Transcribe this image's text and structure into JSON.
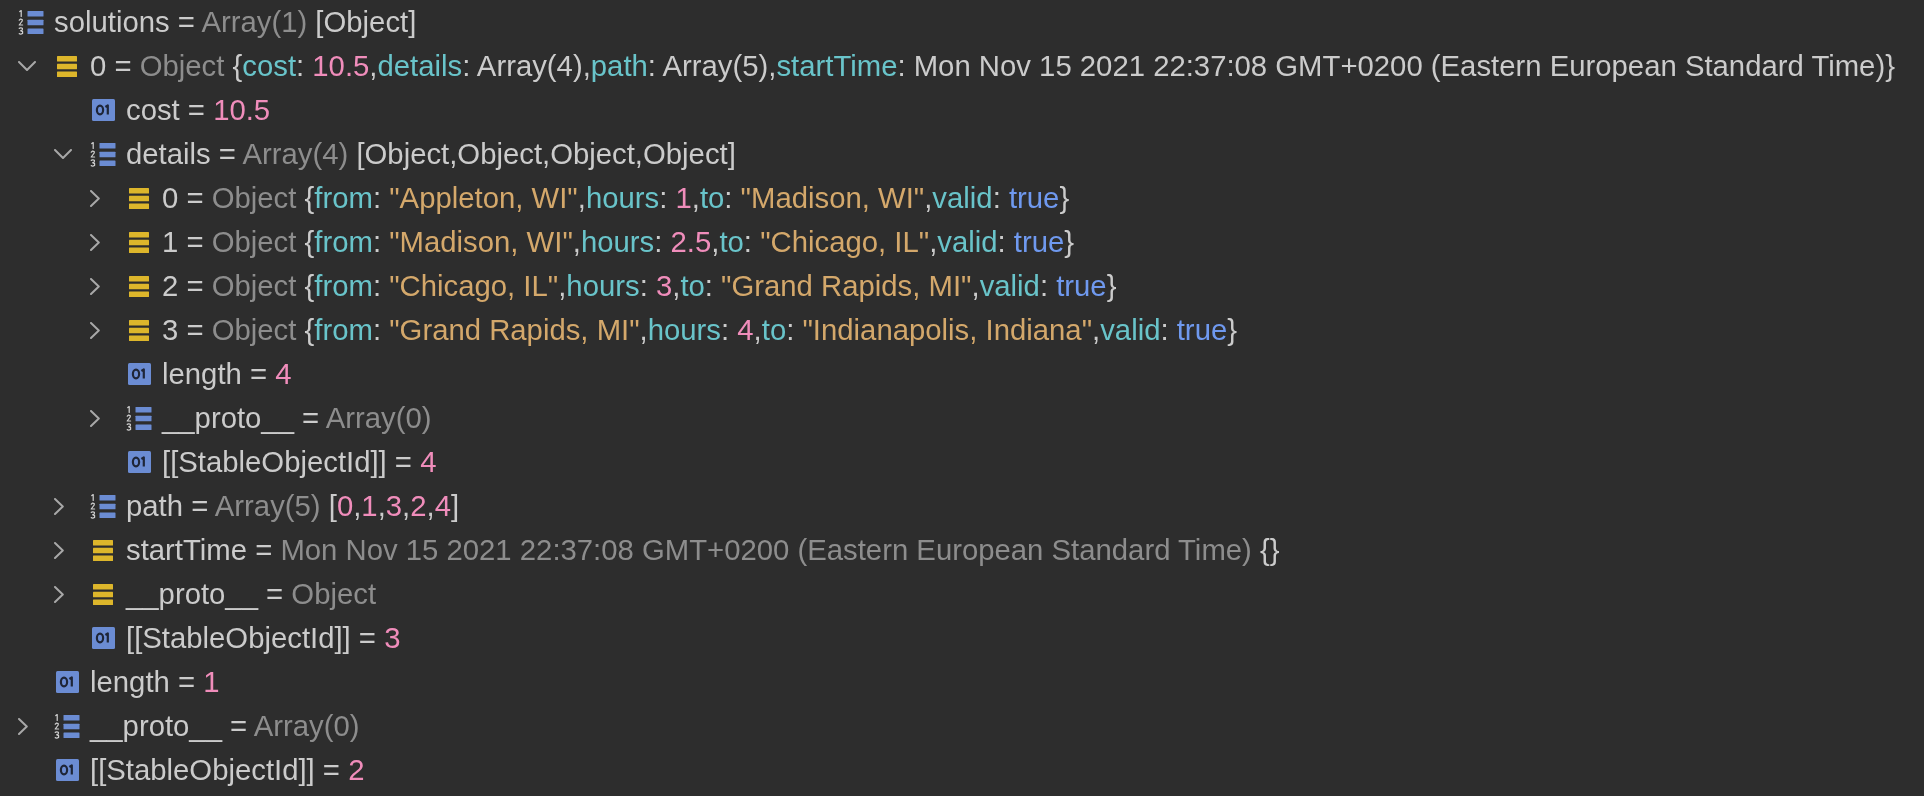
{
  "variables": [
    {
      "kind": "array",
      "line": [
        {
          "kind": "plain",
          "text": "solutions = "
        },
        {
          "kind": "type",
          "text": "Array(1)"
        },
        {
          "kind": "plain",
          "text": " [Object]"
        }
      ],
      "children": [
        {
          "kind": "object",
          "expanded": true,
          "line": [
            {
              "kind": "plain",
              "text": "0 = "
            },
            {
              "kind": "type",
              "text": "Object"
            },
            {
              "kind": "plain",
              "text": " {"
            },
            {
              "kind": "key",
              "text": "cost"
            },
            {
              "kind": "plain",
              "text": ": "
            },
            {
              "kind": "number",
              "text": "10.5"
            },
            {
              "kind": "plain",
              "text": ","
            },
            {
              "kind": "key",
              "text": "details"
            },
            {
              "kind": "plain",
              "text": ": Array(4),"
            },
            {
              "kind": "key",
              "text": "path"
            },
            {
              "kind": "plain",
              "text": ": Array(5),"
            },
            {
              "kind": "key",
              "text": "startTime"
            },
            {
              "kind": "plain",
              "text": ": Mon Nov 15 2021 22:37:08 GMT+0200 (Eastern European Standard Time)}"
            }
          ],
          "children": [
            {
              "kind": "value",
              "line": [
                {
                  "kind": "plain",
                  "text": "cost = "
                },
                {
                  "kind": "number",
                  "text": "10.5"
                }
              ]
            },
            {
              "kind": "array",
              "expanded": true,
              "line": [
                {
                  "kind": "plain",
                  "text": "details = "
                },
                {
                  "kind": "type",
                  "text": "Array(4)"
                },
                {
                  "kind": "plain",
                  "text": " [Object,Object,Object,Object]"
                }
              ],
              "children": [
                {
                  "kind": "object",
                  "expanded": false,
                  "line": [
                    {
                      "kind": "plain",
                      "text": "0 = "
                    },
                    {
                      "kind": "type",
                      "text": "Object"
                    },
                    {
                      "kind": "plain",
                      "text": " {"
                    },
                    {
                      "kind": "key",
                      "text": "from"
                    },
                    {
                      "kind": "plain",
                      "text": ": "
                    },
                    {
                      "kind": "string",
                      "text": "\"Appleton, WI\""
                    },
                    {
                      "kind": "plain",
                      "text": ","
                    },
                    {
                      "kind": "key",
                      "text": "hours"
                    },
                    {
                      "kind": "plain",
                      "text": ": "
                    },
                    {
                      "kind": "number",
                      "text": "1"
                    },
                    {
                      "kind": "plain",
                      "text": ","
                    },
                    {
                      "kind": "key",
                      "text": "to"
                    },
                    {
                      "kind": "plain",
                      "text": ": "
                    },
                    {
                      "kind": "string",
                      "text": "\"Madison, WI\""
                    },
                    {
                      "kind": "plain",
                      "text": ","
                    },
                    {
                      "kind": "key",
                      "text": "valid"
                    },
                    {
                      "kind": "plain",
                      "text": ": "
                    },
                    {
                      "kind": "boolean",
                      "text": "true"
                    },
                    {
                      "kind": "plain",
                      "text": "}"
                    }
                  ]
                },
                {
                  "kind": "object",
                  "expanded": false,
                  "line": [
                    {
                      "kind": "plain",
                      "text": "1 = "
                    },
                    {
                      "kind": "type",
                      "text": "Object"
                    },
                    {
                      "kind": "plain",
                      "text": " {"
                    },
                    {
                      "kind": "key",
                      "text": "from"
                    },
                    {
                      "kind": "plain",
                      "text": ": "
                    },
                    {
                      "kind": "string",
                      "text": "\"Madison, WI\""
                    },
                    {
                      "kind": "plain",
                      "text": ","
                    },
                    {
                      "kind": "key",
                      "text": "hours"
                    },
                    {
                      "kind": "plain",
                      "text": ": "
                    },
                    {
                      "kind": "number",
                      "text": "2.5"
                    },
                    {
                      "kind": "plain",
                      "text": ","
                    },
                    {
                      "kind": "key",
                      "text": "to"
                    },
                    {
                      "kind": "plain",
                      "text": ": "
                    },
                    {
                      "kind": "string",
                      "text": "\"Chicago, IL\""
                    },
                    {
                      "kind": "plain",
                      "text": ","
                    },
                    {
                      "kind": "key",
                      "text": "valid"
                    },
                    {
                      "kind": "plain",
                      "text": ": "
                    },
                    {
                      "kind": "boolean",
                      "text": "true"
                    },
                    {
                      "kind": "plain",
                      "text": "}"
                    }
                  ]
                },
                {
                  "kind": "object",
                  "expanded": false,
                  "line": [
                    {
                      "kind": "plain",
                      "text": "2 = "
                    },
                    {
                      "kind": "type",
                      "text": "Object"
                    },
                    {
                      "kind": "plain",
                      "text": " {"
                    },
                    {
                      "kind": "key",
                      "text": "from"
                    },
                    {
                      "kind": "plain",
                      "text": ": "
                    },
                    {
                      "kind": "string",
                      "text": "\"Chicago, IL\""
                    },
                    {
                      "kind": "plain",
                      "text": ","
                    },
                    {
                      "kind": "key",
                      "text": "hours"
                    },
                    {
                      "kind": "plain",
                      "text": ": "
                    },
                    {
                      "kind": "number",
                      "text": "3"
                    },
                    {
                      "kind": "plain",
                      "text": ","
                    },
                    {
                      "kind": "key",
                      "text": "to"
                    },
                    {
                      "kind": "plain",
                      "text": ": "
                    },
                    {
                      "kind": "string",
                      "text": "\"Grand Rapids, MI\""
                    },
                    {
                      "kind": "plain",
                      "text": ","
                    },
                    {
                      "kind": "key",
                      "text": "valid"
                    },
                    {
                      "kind": "plain",
                      "text": ": "
                    },
                    {
                      "kind": "boolean",
                      "text": "true"
                    },
                    {
                      "kind": "plain",
                      "text": "}"
                    }
                  ]
                },
                {
                  "kind": "object",
                  "expanded": false,
                  "line": [
                    {
                      "kind": "plain",
                      "text": "3 = "
                    },
                    {
                      "kind": "type",
                      "text": "Object"
                    },
                    {
                      "kind": "plain",
                      "text": " {"
                    },
                    {
                      "kind": "key",
                      "text": "from"
                    },
                    {
                      "kind": "plain",
                      "text": ": "
                    },
                    {
                      "kind": "string",
                      "text": "\"Grand Rapids, MI\""
                    },
                    {
                      "kind": "plain",
                      "text": ","
                    },
                    {
                      "kind": "key",
                      "text": "hours"
                    },
                    {
                      "kind": "plain",
                      "text": ": "
                    },
                    {
                      "kind": "number",
                      "text": "4"
                    },
                    {
                      "kind": "plain",
                      "text": ","
                    },
                    {
                      "kind": "key",
                      "text": "to"
                    },
                    {
                      "kind": "plain",
                      "text": ": "
                    },
                    {
                      "kind": "string",
                      "text": "\"Indianapolis, Indiana\""
                    },
                    {
                      "kind": "plain",
                      "text": ","
                    },
                    {
                      "kind": "key",
                      "text": "valid"
                    },
                    {
                      "kind": "plain",
                      "text": ": "
                    },
                    {
                      "kind": "boolean",
                      "text": "true"
                    },
                    {
                      "kind": "plain",
                      "text": "}"
                    }
                  ]
                },
                {
                  "kind": "value",
                  "line": [
                    {
                      "kind": "plain",
                      "text": "length = "
                    },
                    {
                      "kind": "number",
                      "text": "4"
                    }
                  ]
                },
                {
                  "kind": "array",
                  "expanded": false,
                  "line": [
                    {
                      "kind": "plain",
                      "text": "__proto__ = "
                    },
                    {
                      "kind": "type",
                      "text": "Array(0)"
                    }
                  ]
                },
                {
                  "kind": "value",
                  "line": [
                    {
                      "kind": "plain",
                      "text": "[[StableObjectId]] = "
                    },
                    {
                      "kind": "number",
                      "text": "4"
                    }
                  ]
                }
              ]
            },
            {
              "kind": "array",
              "expanded": false,
              "line": [
                {
                  "kind": "plain",
                  "text": "path = "
                },
                {
                  "kind": "type",
                  "text": "Array(5)"
                },
                {
                  "kind": "plain",
                  "text": " ["
                },
                {
                  "kind": "number",
                  "text": "0"
                },
                {
                  "kind": "plain",
                  "text": ","
                },
                {
                  "kind": "number",
                  "text": "1"
                },
                {
                  "kind": "plain",
                  "text": ","
                },
                {
                  "kind": "number",
                  "text": "3"
                },
                {
                  "kind": "plain",
                  "text": ","
                },
                {
                  "kind": "number",
                  "text": "2"
                },
                {
                  "kind": "plain",
                  "text": ","
                },
                {
                  "kind": "number",
                  "text": "4"
                },
                {
                  "kind": "plain",
                  "text": "]"
                }
              ]
            },
            {
              "kind": "object",
              "expanded": false,
              "line": [
                {
                  "kind": "plain",
                  "text": "startTime = "
                },
                {
                  "kind": "type",
                  "text": "Mon Nov 15 2021 22:37:08 GMT+0200 (Eastern European Standard Time)"
                },
                {
                  "kind": "plain",
                  "text": " {}"
                }
              ]
            },
            {
              "kind": "object",
              "expanded": false,
              "line": [
                {
                  "kind": "plain",
                  "text": "__proto__ = "
                },
                {
                  "kind": "type",
                  "text": "Object"
                }
              ]
            },
            {
              "kind": "value",
              "line": [
                {
                  "kind": "plain",
                  "text": "[[StableObjectId]] = "
                },
                {
                  "kind": "number",
                  "text": "3"
                }
              ]
            }
          ]
        },
        {
          "kind": "value",
          "line": [
            {
              "kind": "plain",
              "text": "length = "
            },
            {
              "kind": "number",
              "text": "1"
            }
          ]
        },
        {
          "kind": "array",
          "expanded": false,
          "line": [
            {
              "kind": "plain",
              "text": "__proto__ = "
            },
            {
              "kind": "type",
              "text": "Array(0)"
            }
          ]
        },
        {
          "kind": "value",
          "line": [
            {
              "kind": "plain",
              "text": "[[StableObjectId]] = "
            },
            {
              "kind": "number",
              "text": "2"
            }
          ]
        }
      ]
    }
  ]
}
